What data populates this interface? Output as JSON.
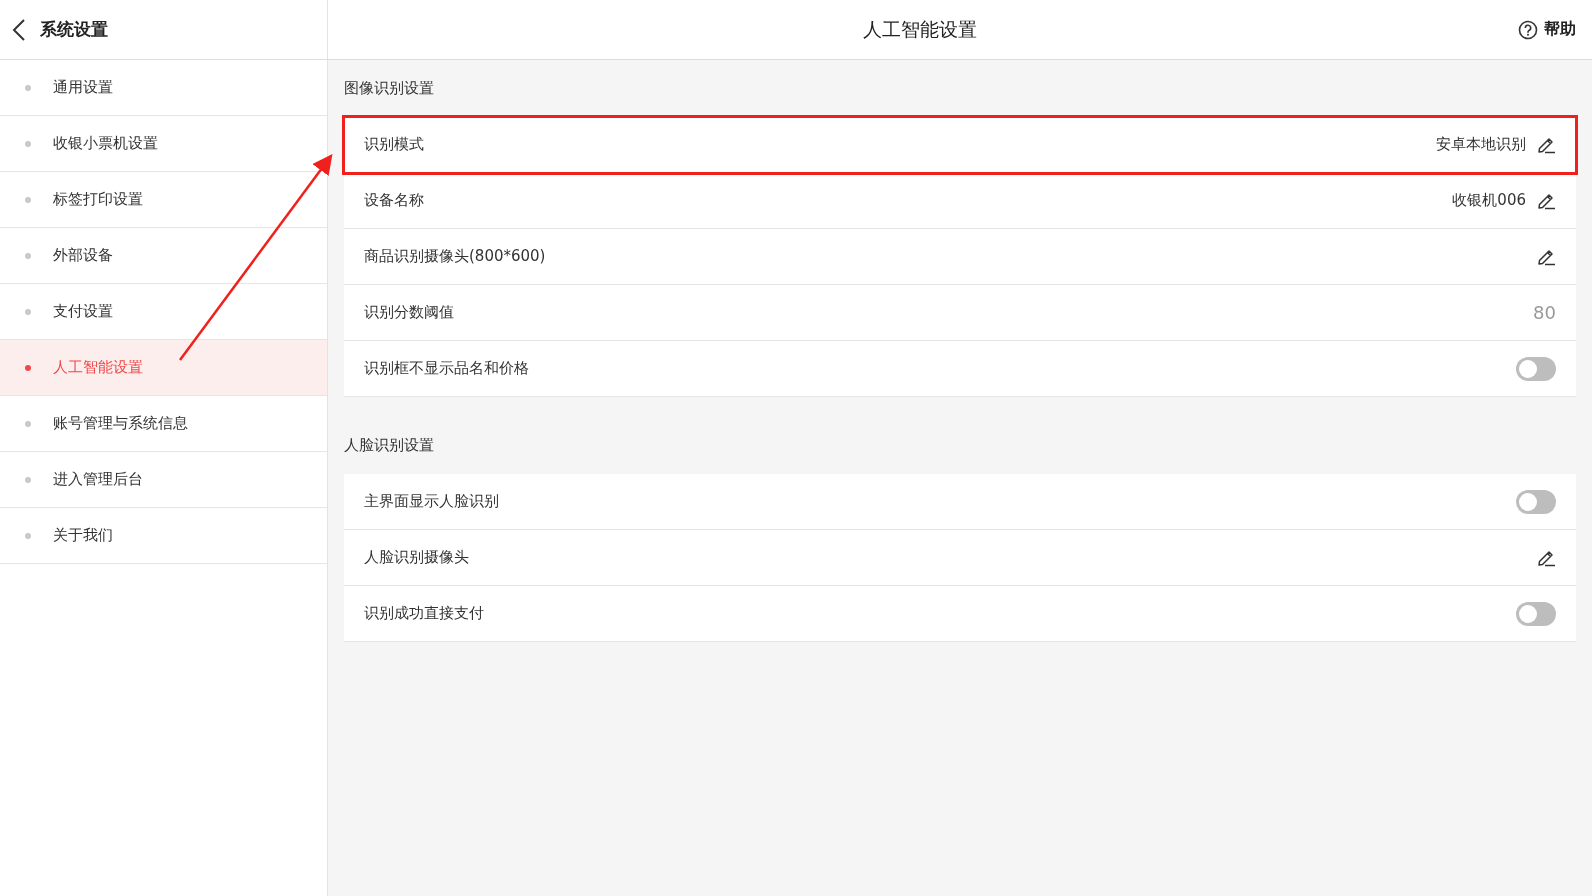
{
  "header": {
    "back_title": "系统设置",
    "title": "人工智能设置",
    "help": "帮助"
  },
  "sidebar": {
    "items": [
      {
        "label": "通用设置",
        "selected": false
      },
      {
        "label": "收银小票机设置",
        "selected": false
      },
      {
        "label": "标签打印设置",
        "selected": false
      },
      {
        "label": "外部设备",
        "selected": false
      },
      {
        "label": "支付设置",
        "selected": false
      },
      {
        "label": "人工智能设置",
        "selected": true
      },
      {
        "label": "账号管理与系统信息",
        "selected": false
      },
      {
        "label": "进入管理后台",
        "selected": false
      },
      {
        "label": "关于我们",
        "selected": false
      }
    ]
  },
  "sections": [
    {
      "title": "图像识别设置",
      "rows": [
        {
          "kind": "edit",
          "label": "识别模式",
          "value": "安卓本地识别",
          "highlighted": true
        },
        {
          "kind": "edit",
          "label": "设备名称",
          "value": "收银机006",
          "highlighted": false
        },
        {
          "kind": "edit",
          "label": "商品识别摄像头(800*600)",
          "highlighted": false
        },
        {
          "kind": "number",
          "label": "识别分数阈值",
          "value": "80",
          "highlighted": false
        },
        {
          "kind": "toggle",
          "label": "识别框不显示品名和价格",
          "on": false,
          "highlighted": false
        }
      ]
    },
    {
      "title": "人脸识别设置",
      "rows": [
        {
          "kind": "toggle",
          "label": "主界面显示人脸识别",
          "on": false,
          "highlighted": false
        },
        {
          "kind": "edit",
          "label": "人脸识别摄像头",
          "highlighted": false
        },
        {
          "kind": "toggle",
          "label": "识别成功直接支付",
          "on": false,
          "highlighted": false
        }
      ]
    }
  ]
}
